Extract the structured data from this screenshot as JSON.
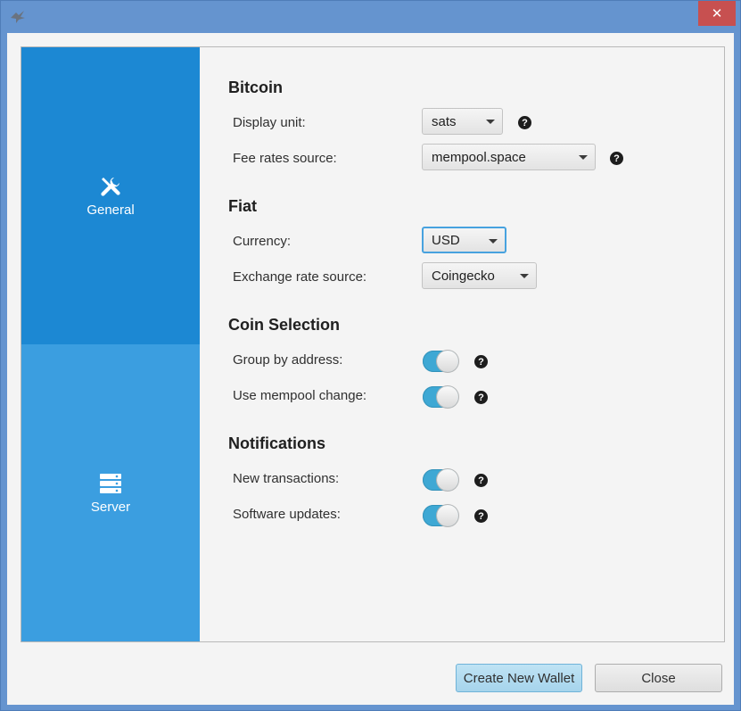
{
  "window": {
    "app_icon": "bird-icon",
    "close_glyph": "✕",
    "close_color": "#c75050"
  },
  "sidebar": {
    "items": [
      {
        "label": "General",
        "icon": "tools-icon",
        "color": "#1c88d3"
      },
      {
        "label": "Server",
        "icon": "server-icon",
        "color": "#3b9ee0"
      }
    ]
  },
  "sections": {
    "bitcoin": {
      "title": "Bitcoin",
      "display_unit": {
        "label": "Display unit:",
        "value": "sats"
      },
      "fee_rates_source": {
        "label": "Fee rates source:",
        "value": "mempool.space"
      }
    },
    "fiat": {
      "title": "Fiat",
      "currency": {
        "label": "Currency:",
        "value": "USD"
      },
      "exchange_rate_source": {
        "label": "Exchange rate source:",
        "value": "Coingecko"
      }
    },
    "coin_selection": {
      "title": "Coin Selection",
      "group_by_address": {
        "label": "Group by address:",
        "enabled": true
      },
      "use_mempool_change": {
        "label": "Use mempool change:",
        "enabled": true
      }
    },
    "notifications": {
      "title": "Notifications",
      "new_transactions": {
        "label": "New transactions:",
        "enabled": true
      },
      "software_updates": {
        "label": "Software updates:",
        "enabled": true
      }
    }
  },
  "help_glyph": "?",
  "buttons": {
    "create_new_wallet": "Create New Wallet",
    "close": "Close"
  },
  "colors": {
    "accent": "#1c88d3",
    "toggle_on": "#3ea8d4"
  }
}
